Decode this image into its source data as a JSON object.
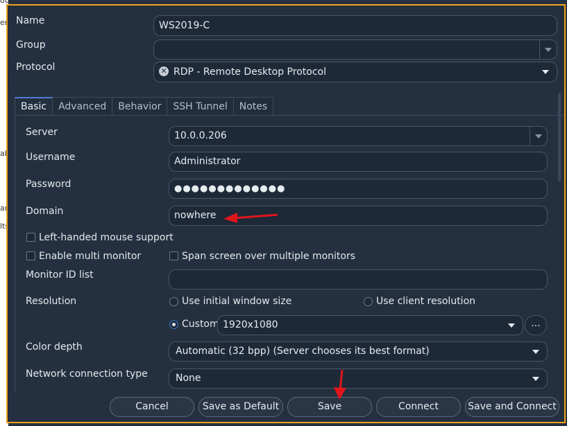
{
  "window": {
    "accent_border": "#f4a21a",
    "bg_fragments": [
      "oup",
      "er",
      "ab",
      "an",
      "lts"
    ]
  },
  "top": {
    "name_label": "Name",
    "name_value": "WS2019-C",
    "group_label": "Group",
    "group_value": "",
    "protocol_label": "Protocol",
    "protocol_value": "RDP - Remote Desktop Protocol",
    "protocol_icon": "rdp-plugin-icon"
  },
  "tabs": [
    "Basic",
    "Advanced",
    "Behavior",
    "SSH Tunnel",
    "Notes"
  ],
  "active_tab": "Basic",
  "basic": {
    "server_label": "Server",
    "server_value": "10.0.0.206",
    "username_label": "Username",
    "username_value": "Administrator",
    "password_label": "Password",
    "password_value": "●●●●●●●●●●●●●",
    "domain_label": "Domain",
    "domain_value": "nowhere",
    "left_handed_label": "Left-handed mouse support",
    "left_handed_checked": false,
    "multi_monitor_label": "Enable multi monitor",
    "multi_monitor_checked": false,
    "span_screen_label": "Span screen over multiple monitors",
    "span_screen_checked": false,
    "monitor_id_label": "Monitor ID list",
    "monitor_id_value": "",
    "resolution_label": "Resolution",
    "res_initial_label": "Use initial window size",
    "res_client_label": "Use client resolution",
    "res_custom_label": "Custom",
    "res_custom_value": "1920x1080",
    "res_more_label": "...",
    "color_depth_label": "Color depth",
    "color_depth_value": "Automatic (32 bpp) (Server chooses its best format)",
    "network_label": "Network connection type",
    "network_value": "None"
  },
  "buttons": {
    "cancel": "Cancel",
    "save_default": "Save as Default",
    "save": "Save",
    "connect": "Connect",
    "save_connect": "Save and Connect"
  },
  "annotation_color": "#e0161b"
}
